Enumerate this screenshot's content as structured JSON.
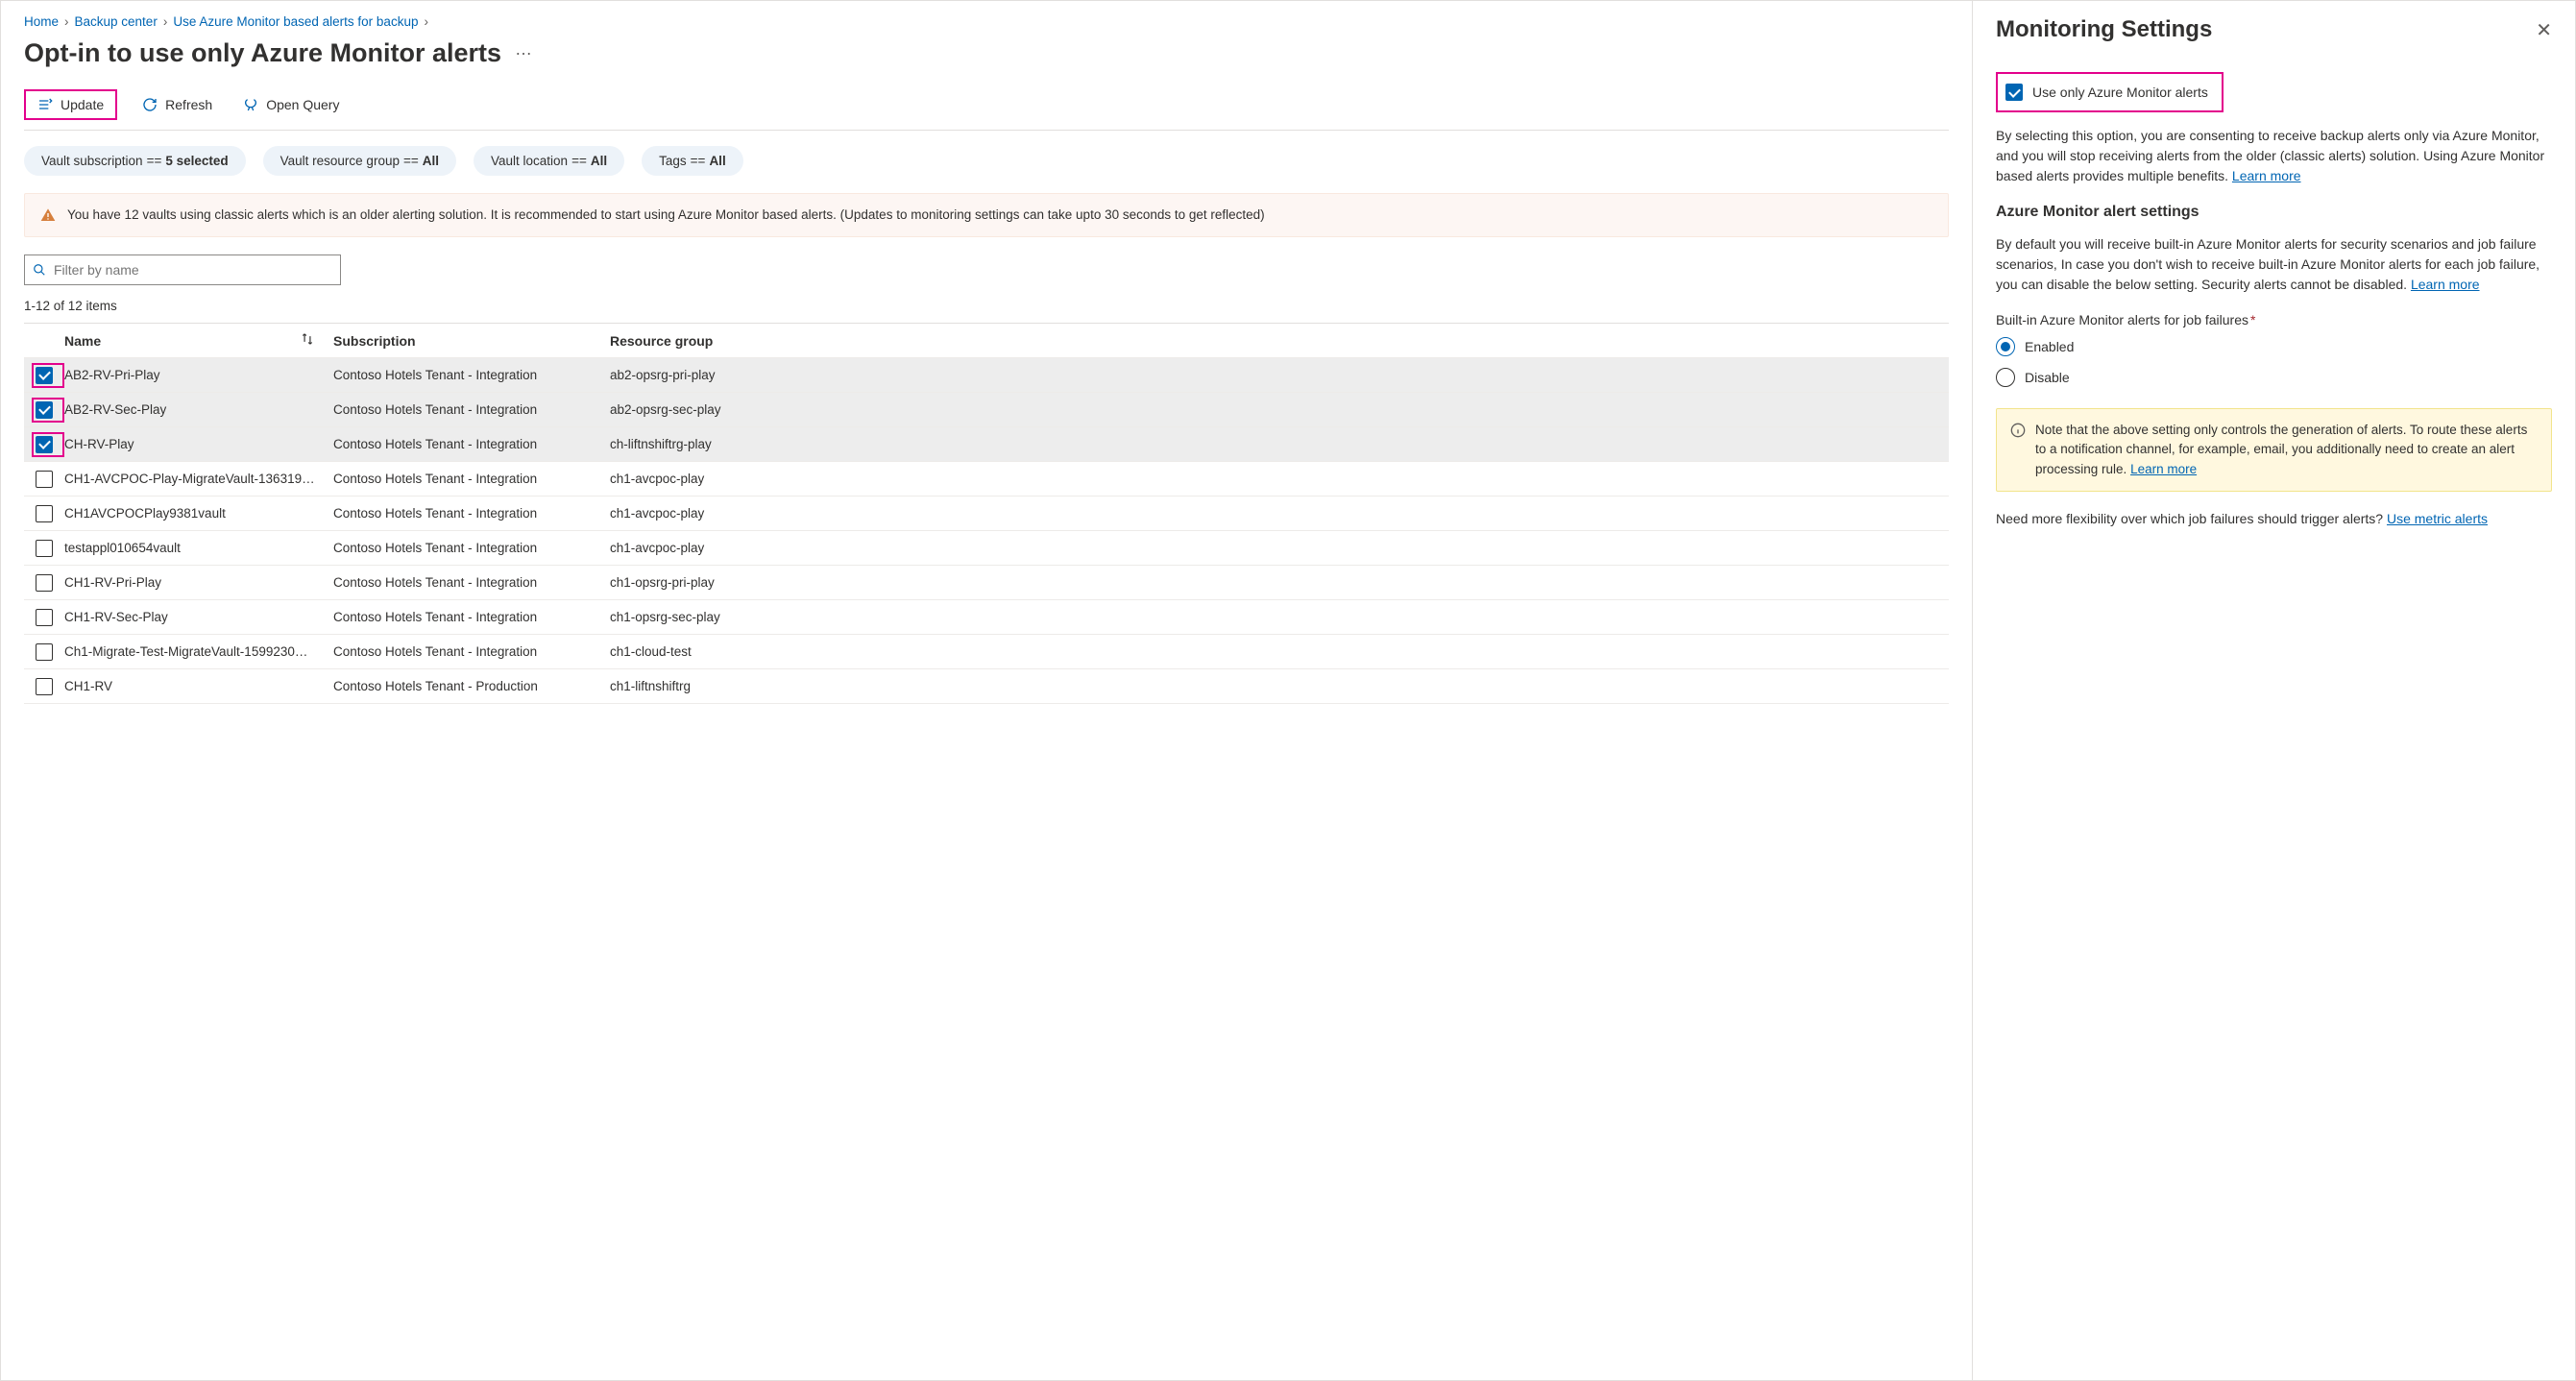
{
  "breadcrumb": {
    "home": "Home",
    "center": "Backup center",
    "alerts": "Use Azure Monitor based alerts for backup"
  },
  "page_title": "Opt-in to use only Azure Monitor alerts",
  "toolbar": {
    "update": "Update",
    "refresh": "Refresh",
    "open_query": "Open Query"
  },
  "filters": {
    "sub_label": "Vault subscription ",
    "sub_eq": "==",
    "sub_val": "5 selected",
    "rg_label": "Vault resource group ",
    "rg_eq": "==",
    "rg_val": "All",
    "loc_label": "Vault location ",
    "loc_eq": "==",
    "loc_val": "All",
    "tag_label": "Tags ",
    "tag_eq": "==",
    "tag_val": "All"
  },
  "banner": "You have 12 vaults using classic alerts which is an older alerting solution. It is recommended to start using Azure Monitor based alerts. (Updates to monitoring settings can take upto 30 seconds to get reflected)",
  "filter_placeholder": "Filter by name",
  "count": "1-12 of 12 items",
  "columns": {
    "name": "Name",
    "subscription": "Subscription",
    "rg": "Resource group"
  },
  "rows": [
    {
      "checked": true,
      "name": "AB2-RV-Pri-Play",
      "sub": "Contoso Hotels Tenant - Integration",
      "rg": "ab2-opsrg-pri-play"
    },
    {
      "checked": true,
      "name": "AB2-RV-Sec-Play",
      "sub": "Contoso Hotels Tenant - Integration",
      "rg": "ab2-opsrg-sec-play"
    },
    {
      "checked": true,
      "name": "CH-RV-Play",
      "sub": "Contoso Hotels Tenant - Integration",
      "rg": "ch-liftnshiftrg-play"
    },
    {
      "checked": false,
      "name": "CH1-AVCPOC-Play-MigrateVault-136319…",
      "sub": "Contoso Hotels Tenant - Integration",
      "rg": "ch1-avcpoc-play"
    },
    {
      "checked": false,
      "name": "CH1AVCPOCPlay9381vault",
      "sub": "Contoso Hotels Tenant - Integration",
      "rg": "ch1-avcpoc-play"
    },
    {
      "checked": false,
      "name": "testappl010654vault",
      "sub": "Contoso Hotels Tenant - Integration",
      "rg": "ch1-avcpoc-play"
    },
    {
      "checked": false,
      "name": "CH1-RV-Pri-Play",
      "sub": "Contoso Hotels Tenant - Integration",
      "rg": "ch1-opsrg-pri-play"
    },
    {
      "checked": false,
      "name": "CH1-RV-Sec-Play",
      "sub": "Contoso Hotels Tenant - Integration",
      "rg": "ch1-opsrg-sec-play"
    },
    {
      "checked": false,
      "name": "Ch1-Migrate-Test-MigrateVault-1599230…",
      "sub": "Contoso Hotels Tenant - Integration",
      "rg": "ch1-cloud-test"
    },
    {
      "checked": false,
      "name": "CH1-RV",
      "sub": "Contoso Hotels Tenant - Production",
      "rg": "ch1-liftnshiftrg"
    }
  ],
  "panel": {
    "title": "Monitoring Settings",
    "opt_label": "Use only Azure Monitor alerts",
    "opt_desc": "By selecting this option, you are consenting to receive backup alerts only via Azure Monitor, and you will stop receiving alerts from the older (classic alerts) solution. Using Azure Monitor based alerts provides multiple benefits. ",
    "learn_more": "Learn more",
    "settings_title": "Azure Monitor alert settings",
    "settings_desc": "By default you will receive built-in Azure Monitor alerts for security scenarios and job failure scenarios, In case you don't wish to receive built-in Azure Monitor alerts for each job failure, you can disable the below setting. Security alerts cannot be disabled. ",
    "field_label": "Built-in Azure Monitor alerts for job failures",
    "enabled": "Enabled",
    "disable": "Disable",
    "note": "Note that the above setting only controls the generation of alerts. To route these alerts to a notification channel, for example, email, you additionally need to create an alert processing rule.  ",
    "flex_text": "Need more flexibility over which job failures should trigger alerts? ",
    "metric_link": "Use metric alerts"
  }
}
